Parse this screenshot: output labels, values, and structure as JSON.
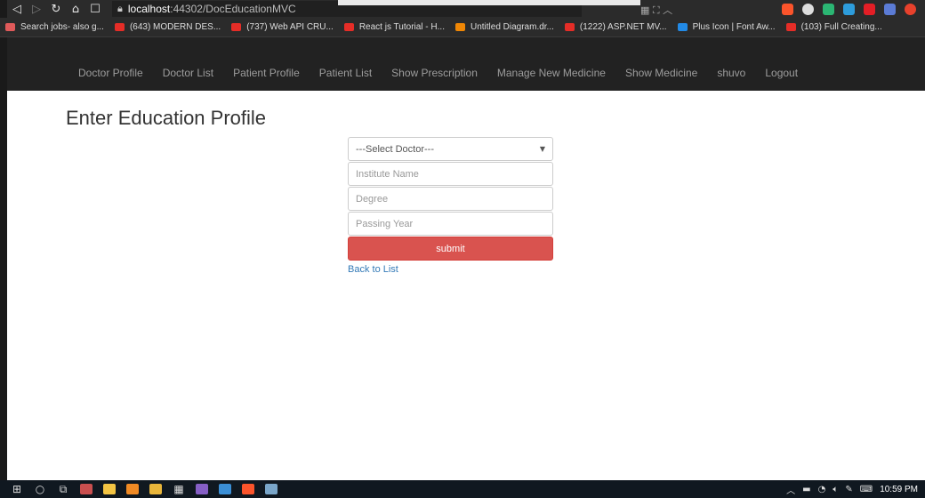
{
  "browser": {
    "url_host": "localhost",
    "url_path": ":44302/DocEducationMVC",
    "bookmarks": [
      {
        "label": "Search jobs- also g...",
        "color": "#e05a5a"
      },
      {
        "label": "(643) MODERN DES...",
        "color": "#e52d27"
      },
      {
        "label": "(737) Web API CRU...",
        "color": "#e52d27"
      },
      {
        "label": "React js Tutorial - H...",
        "color": "#e52d27"
      },
      {
        "label": "Untitled Diagram.dr...",
        "color": "#f08705"
      },
      {
        "label": "(1222) ASP.NET MV...",
        "color": "#e52d27"
      },
      {
        "label": "Plus Icon | Font Aw...",
        "color": "#228ae6"
      },
      {
        "label": "(103) Full Creating...",
        "color": "#e52d27"
      }
    ]
  },
  "navbar": {
    "items": [
      "Doctor Profile",
      "Doctor List",
      "Patient Profile",
      "Patient List",
      "Show Prescription",
      "Manage New Medicine",
      "Show Medicine",
      "shuvo",
      "Logout"
    ]
  },
  "page": {
    "title": "Enter Education Profile",
    "doctor_select": "---Select Doctor---",
    "institute_placeholder": "Institute Name",
    "degree_placeholder": "Degree",
    "passing_year_placeholder": "Passing Year",
    "submit_label": "submit",
    "back_link": "Back to List"
  },
  "taskbar": {
    "time": "10:59 PM"
  },
  "colors": {
    "navbar_bg": "#222222",
    "submit_bg": "#d9534f",
    "link": "#337ab7"
  }
}
